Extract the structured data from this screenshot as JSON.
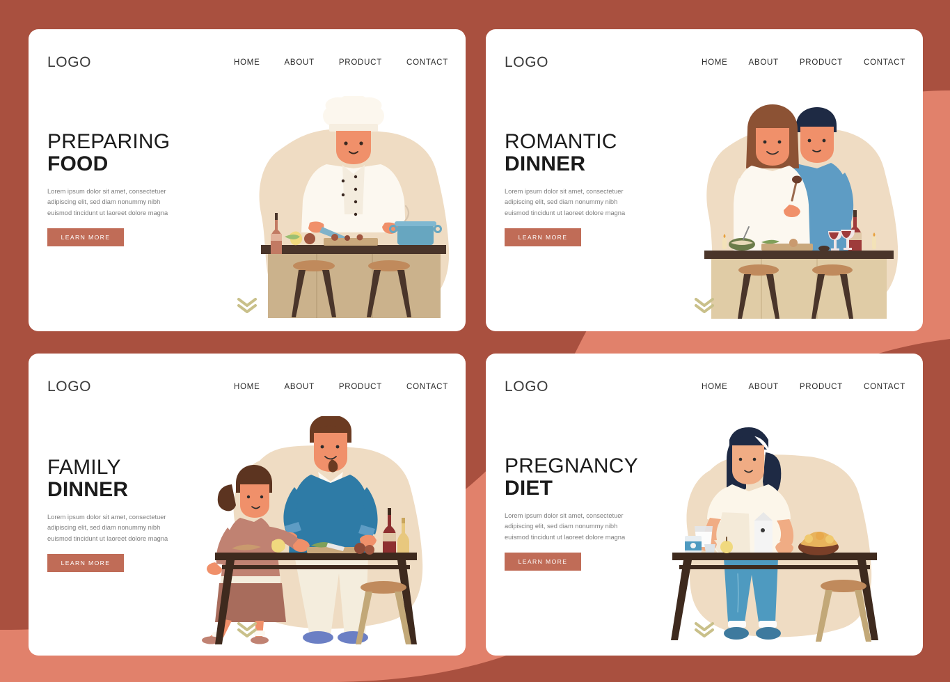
{
  "palette": {
    "bg_dark": "#A9503F",
    "bg_light": "#E1816B",
    "card_bg": "#FFFFFF",
    "button": "#C06C57",
    "blob": "#EFDCC3",
    "chevron": "#C9C08A",
    "heading": "#1B1B1B",
    "body_text": "#7D7D7D"
  },
  "nav_items": [
    "HOME",
    "ABOUT",
    "PRODUCT",
    "CONTACT"
  ],
  "common": {
    "logo": "LOGO",
    "body_copy": "Lorem ipsum dolor sit amet, consectetuer adipiscing elit, sed diam nonummy nibh euismod tincidunt ut laoreet dolore magna",
    "button_label": "LEARN MORE",
    "scroll_icon": "double-chevron-down-icon"
  },
  "cards": [
    {
      "id": "preparing-food",
      "headline_line1": "PREPARING",
      "headline_line2": "FOOD",
      "illustration_name": "chef-chopping-vegetables-at-kitchen-island"
    },
    {
      "id": "romantic-dinner",
      "headline_line1": "ROMANTIC",
      "headline_line2": "DINNER",
      "illustration_name": "couple-cooking-with-wine-at-kitchen-island"
    },
    {
      "id": "family-dinner",
      "headline_line1": "FAMILY",
      "headline_line2": "DINNER",
      "illustration_name": "father-and-daughter-preparing-meal-at-table"
    },
    {
      "id": "pregnancy-diet",
      "headline_line1": "PREGNANCY",
      "headline_line2": "DIET",
      "illustration_name": "pregnant-woman-with-milk-and-fruit-at-table"
    }
  ]
}
